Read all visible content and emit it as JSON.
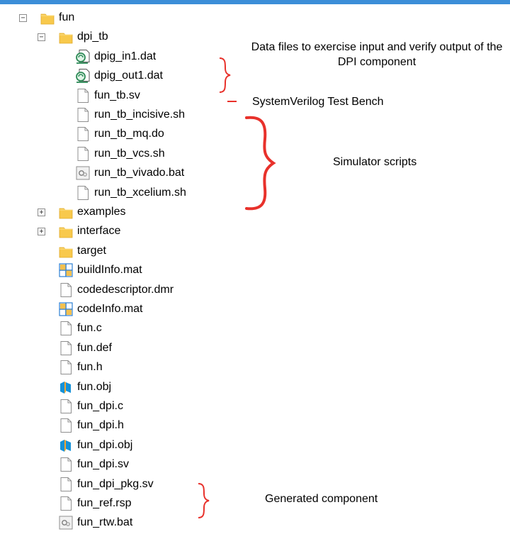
{
  "tree": [
    {
      "label": "fun",
      "icon": "folder-icon",
      "expander": "minus"
    },
    {
      "label": "dpi_tb",
      "icon": "folder-icon",
      "expander": "minus"
    },
    {
      "label": "dpig_in1.dat",
      "icon": "data-file-icon"
    },
    {
      "label": "dpig_out1.dat",
      "icon": "data-file-icon"
    },
    {
      "label": "fun_tb.sv",
      "icon": "file-icon"
    },
    {
      "label": "run_tb_incisive.sh",
      "icon": "file-icon"
    },
    {
      "label": "run_tb_mq.do",
      "icon": "file-icon"
    },
    {
      "label": "run_tb_vcs.sh",
      "icon": "file-icon"
    },
    {
      "label": "run_tb_vivado.bat",
      "icon": "batch-file-icon"
    },
    {
      "label": "run_tb_xcelium.sh",
      "icon": "file-icon"
    },
    {
      "label": "examples",
      "icon": "folder-icon",
      "expander": "plus"
    },
    {
      "label": "interface",
      "icon": "folder-icon",
      "expander": "plus"
    },
    {
      "label": "target",
      "icon": "folder-icon"
    },
    {
      "label": "buildInfo.mat",
      "icon": "mat-file-icon"
    },
    {
      "label": "codedescriptor.dmr",
      "icon": "file-icon"
    },
    {
      "label": "codeInfo.mat",
      "icon": "mat-file-icon"
    },
    {
      "label": "fun.c",
      "icon": "file-icon"
    },
    {
      "label": "fun.def",
      "icon": "file-icon"
    },
    {
      "label": "fun.h",
      "icon": "file-icon"
    },
    {
      "label": "fun.obj",
      "icon": "obj-file-icon"
    },
    {
      "label": "fun_dpi.c",
      "icon": "file-icon"
    },
    {
      "label": "fun_dpi.h",
      "icon": "file-icon"
    },
    {
      "label": "fun_dpi.obj",
      "icon": "obj-file-icon"
    },
    {
      "label": "fun_dpi.sv",
      "icon": "file-icon"
    },
    {
      "label": "fun_dpi_pkg.sv",
      "icon": "file-icon"
    },
    {
      "label": "fun_ref.rsp",
      "icon": "file-icon"
    },
    {
      "label": "fun_rtw.bat",
      "icon": "batch-file-icon"
    }
  ],
  "annotations": {
    "data_files": "Data files to exercise input and verify output of the DPI component",
    "test_bench": "SystemVerilog Test Bench",
    "simulator_scripts": "Simulator scripts",
    "generated_component": "Generated component"
  },
  "colors": {
    "brace": "#e8312b",
    "folder": "#f8c94c",
    "mat_grid": "#2d7fd3",
    "obj_blue": "#1591d8",
    "data_green": "#2e8b57",
    "top_bar": "#3c8ed8"
  }
}
